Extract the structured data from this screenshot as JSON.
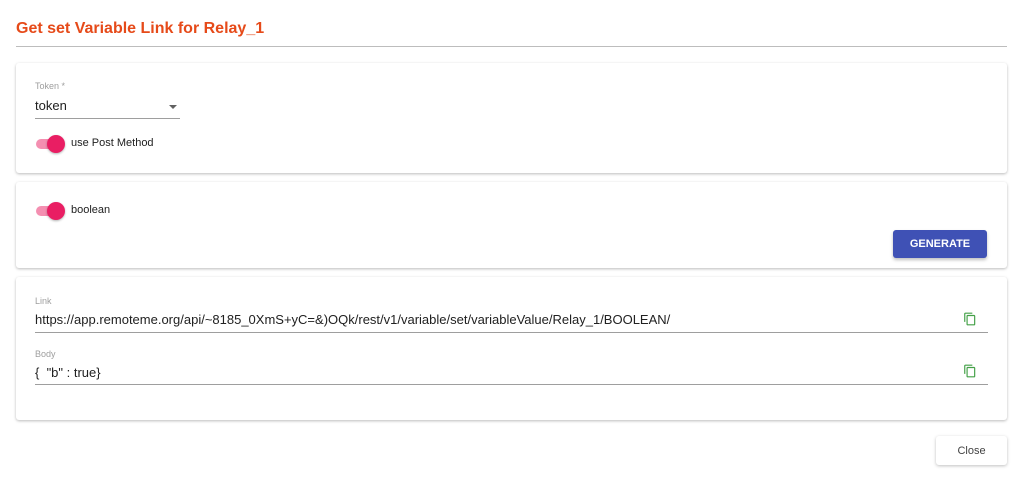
{
  "dialog": {
    "title": "Get set Variable Link for Relay_1",
    "title_color": "#e64a19"
  },
  "token": {
    "label": "Token *",
    "value": "token"
  },
  "post_method": {
    "label": "use Post Method",
    "checked": true
  },
  "boolean_toggle": {
    "label": "boolean",
    "checked": true
  },
  "generate_button": {
    "label": "GENERATE",
    "color": "#3f51b5"
  },
  "link": {
    "label": "Link",
    "value": "https://app.remoteme.org/api/~8185_0XmS+yC=&)OQk/rest/v1/variable/set/variableValue/Relay_1/BOOLEAN/",
    "copy_icon": "copy-icon"
  },
  "body": {
    "label": "Body",
    "value": "{  \"b\" : true}",
    "copy_icon": "copy-icon"
  },
  "close_button": {
    "label": "Close"
  },
  "colors": {
    "toggle_thumb": "#e91e63",
    "toggle_track": "#f48fb1",
    "copy_icon": "#43a047"
  }
}
